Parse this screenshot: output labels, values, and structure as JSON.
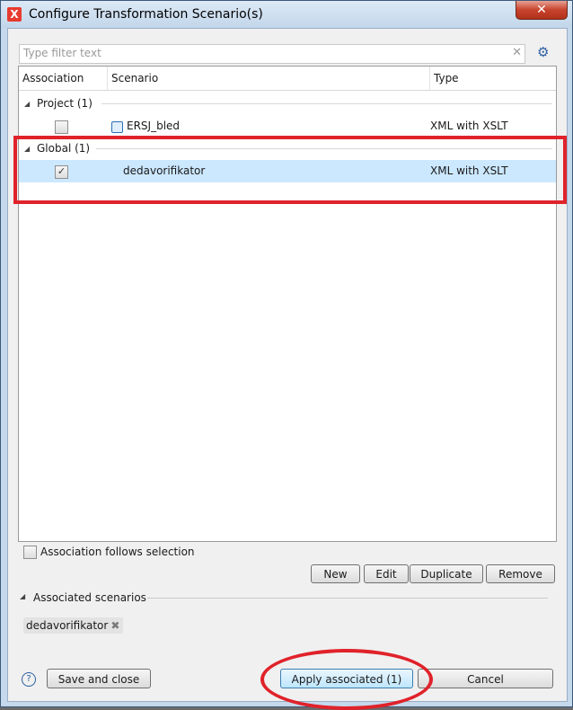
{
  "window": {
    "title": "Configure Transformation Scenario(s)"
  },
  "filter": {
    "placeholder": "Type filter text",
    "value": ""
  },
  "table": {
    "headers": {
      "association": "Association",
      "scenario": "Scenario",
      "type": "Type"
    },
    "groups": [
      {
        "label": "Project (1)",
        "rows": [
          {
            "associated": false,
            "scenario": "ERSJ_bled",
            "type": "XML with XSLT",
            "icon": "scenario-icon"
          }
        ]
      },
      {
        "label": "Global (1)",
        "rows": [
          {
            "associated": true,
            "scenario": "dedavorifikator",
            "type": "XML with XSLT",
            "selected": true
          }
        ]
      }
    ]
  },
  "follow_selection": {
    "label": "Association follows selection",
    "checked": false
  },
  "buttons": {
    "new": "New",
    "edit": "Edit",
    "duplicate": "Duplicate",
    "remove": "Remove",
    "save_close": "Save and close",
    "apply_associated": "Apply associated (1)",
    "cancel": "Cancel"
  },
  "associated": {
    "label": "Associated scenarios",
    "items": [
      "dedavorifikator"
    ]
  },
  "colors": {
    "selection": "#cce8ff",
    "annotation_red": "#e0222a"
  }
}
